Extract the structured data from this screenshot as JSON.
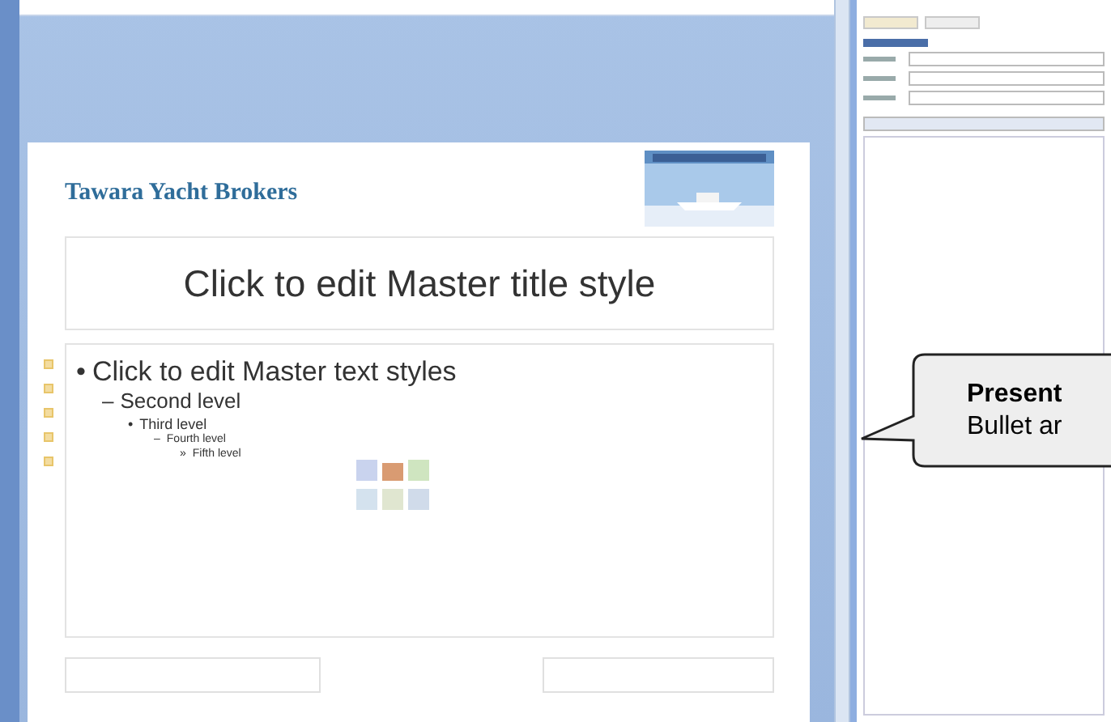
{
  "slide": {
    "company_name": "Tawara Yacht Brokers",
    "title_placeholder": "Click to edit Master title style",
    "text_levels": [
      {
        "bullet": "•",
        "text": "Click to edit Master text styles",
        "children": [
          {
            "bullet": "–",
            "text": "Second level",
            "children": [
              {
                "bullet": "•",
                "text": "Third level",
                "children": [
                  {
                    "bullet": "–",
                    "text": "Fourth level",
                    "children": [
                      {
                        "bullet": "»",
                        "text": "Fifth level"
                      }
                    ]
                  }
                ]
              }
            ]
          }
        ]
      }
    ]
  },
  "callout": {
    "title": "Present",
    "body": "Bullet ar"
  }
}
